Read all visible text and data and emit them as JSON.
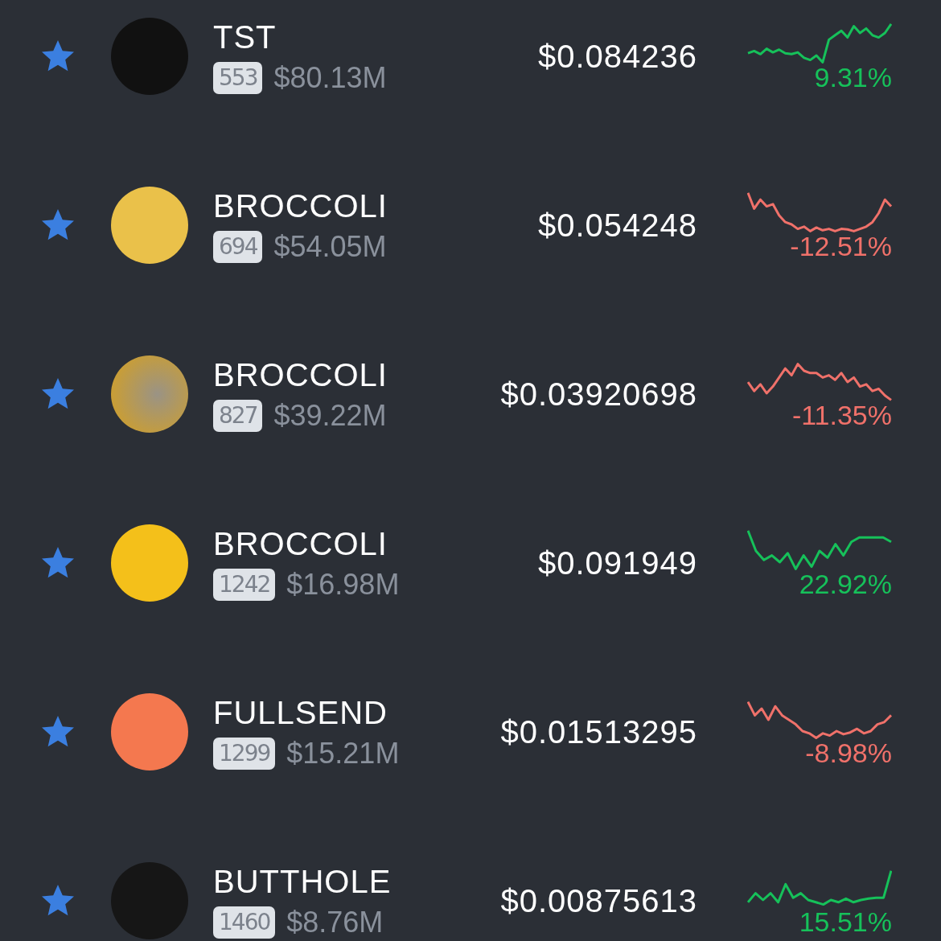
{
  "tokens": [
    {
      "starred": true,
      "name": "TST",
      "rank": "553",
      "market_cap": "$80.13M",
      "price": "$0.084236",
      "change": "9.31%",
      "color": "#16c15a"
    },
    {
      "starred": true,
      "name": "BROCCOLI",
      "rank": "694",
      "market_cap": "$54.05M",
      "price": "$0.054248",
      "change": "-12.51%",
      "color": "#f0716a"
    },
    {
      "starred": true,
      "name": "BROCCOLI",
      "rank": "827",
      "market_cap": "$39.22M",
      "price": "$0.03920698",
      "change": "-11.35%",
      "color": "#f0716a"
    },
    {
      "starred": true,
      "name": "BROCCOLI",
      "rank": "1242",
      "market_cap": "$16.98M",
      "price": "$0.091949",
      "change": "22.92%",
      "color": "#16c15a"
    },
    {
      "starred": true,
      "name": "FULLSEND",
      "rank": "1299",
      "market_cap": "$15.21M",
      "price": "$0.01513295",
      "change": "-8.98%",
      "color": "#f0716a"
    },
    {
      "starred": true,
      "name": "BUTTHOLE",
      "rank": "1460",
      "market_cap": "$8.76M",
      "price": "$0.00875613",
      "change": "15.51%",
      "color": "#16c15a"
    }
  ]
}
